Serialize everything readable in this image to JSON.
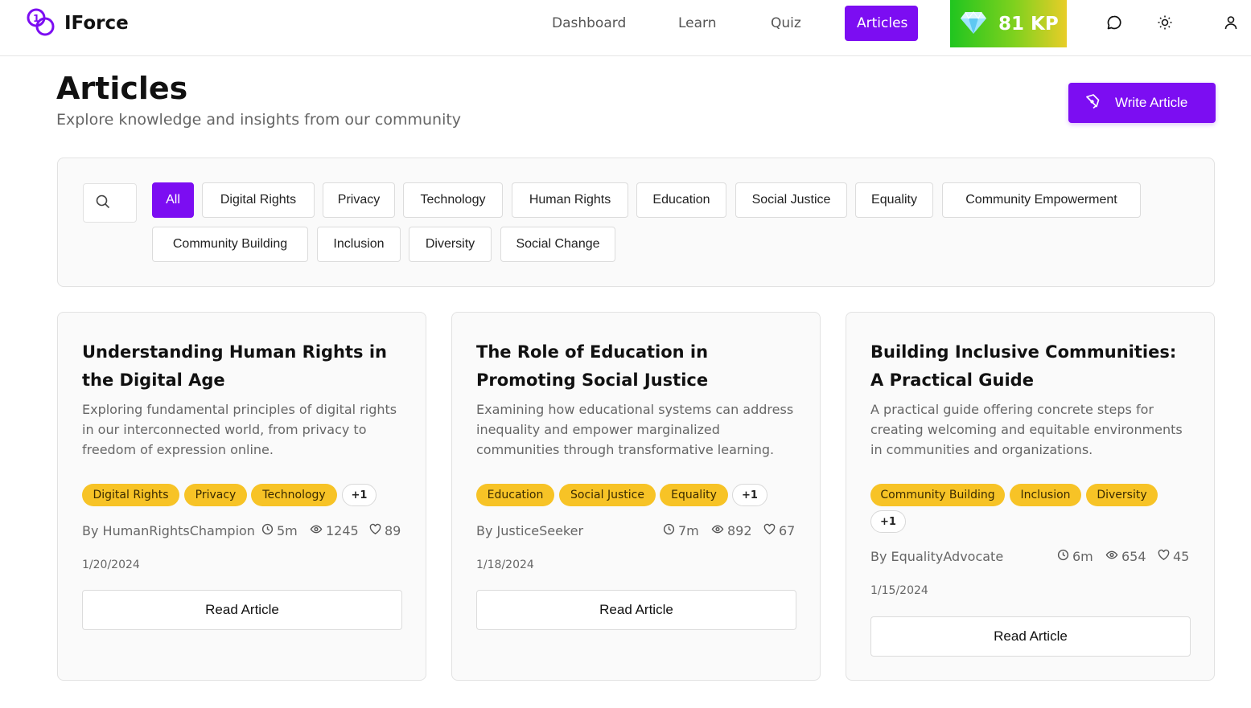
{
  "app": {
    "name": "IForce"
  },
  "nav": {
    "dashboard": "Dashboard",
    "learn": "Learn",
    "quiz": "Quiz",
    "articles": "Articles"
  },
  "kp": {
    "label": "81 KP"
  },
  "page": {
    "title": "Articles",
    "subtitle": "Explore knowledge and insights from our community",
    "write_button": "Write Article"
  },
  "filters": {
    "search_placeholder": "",
    "categories": [
      "All",
      "Digital Rights",
      "Privacy",
      "Technology",
      "Human Rights",
      "Education",
      "Social Justice",
      "Equality",
      "Community Empowerment",
      "Community Building",
      "Inclusion",
      "Diversity",
      "Social Change"
    ],
    "selected": "All"
  },
  "articles": [
    {
      "title": "Understanding Human Rights in the Digital Age",
      "description": "Exploring fundamental principles of digital rights in our interconnected world, from privacy to freedom of expression online.",
      "tags": [
        "Digital Rights",
        "Privacy",
        "Technology"
      ],
      "more_tags": "+1",
      "author": "By HumanRightsChampion",
      "read_time": "5m",
      "views": "1245",
      "likes": "89",
      "date": "1/20/2024",
      "button": "Read Article"
    },
    {
      "title": "The Role of Education in Promoting Social Justice",
      "description": "Examining how educational systems can address inequality and empower marginalized communities through transformative learning.",
      "tags": [
        "Education",
        "Social Justice",
        "Equality"
      ],
      "more_tags": "+1",
      "author": "By JusticeSeeker",
      "read_time": "7m",
      "views": "892",
      "likes": "67",
      "date": "1/18/2024",
      "button": "Read Article"
    },
    {
      "title": "Building Inclusive Communities: A Practical Guide",
      "description": "A practical guide offering concrete steps for creating welcoming and equitable environments in communities and organizations.",
      "tags": [
        "Community Building",
        "Inclusion",
        "Diversity"
      ],
      "more_tags": "+1",
      "author": "By EqualityAdvocate",
      "read_time": "6m",
      "views": "654",
      "likes": "45",
      "date": "1/15/2024",
      "button": "Read Article"
    }
  ],
  "icons": {
    "logo": "iforce-logo-icon",
    "kp": "diamond-icon",
    "chat": "chat-bubble-icon",
    "theme": "sun-icon",
    "user": "user-icon",
    "write": "pen-icon",
    "search": "search-icon",
    "clock": "clock-icon",
    "eye": "eye-icon",
    "heart": "heart-icon"
  },
  "colors": {
    "accent": "#7c0df2",
    "tag": "#f7c326",
    "kp_start": "#20c51f",
    "kp_end": "#e8cd28"
  }
}
